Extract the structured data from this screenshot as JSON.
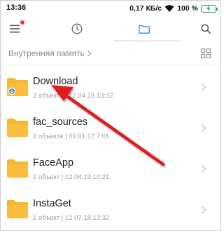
{
  "status": {
    "time": "13:36",
    "speed": "0,17 КБ/с",
    "battery": "100 %"
  },
  "toolbar": {
    "icons": [
      "menu-icon",
      "clock-icon",
      "folder-icon",
      "search-icon"
    ],
    "active_tab": "folder"
  },
  "breadcrumb": {
    "label": "Внутренняя память"
  },
  "colors": {
    "accent": "#2f8fd8",
    "folder": "#f9b52b",
    "folder_dark": "#eea41a",
    "arrow": "#e21a1a",
    "badge": "#e53935",
    "battery": "#1fa35a"
  },
  "files": [
    {
      "name": "Download",
      "meta": "2 объекта | 12.04.19 13:32",
      "sync_badge": true
    },
    {
      "name": "fac_sources",
      "meta": "2 объекта | 01.01.17 7:01",
      "sync_badge": false
    },
    {
      "name": "FaceApp",
      "meta": "1 объект | 12.04.19 10:21",
      "sync_badge": false
    },
    {
      "name": "InstaGet",
      "meta": "1 объект | 12.07.18 13:32",
      "sync_badge": false
    }
  ]
}
